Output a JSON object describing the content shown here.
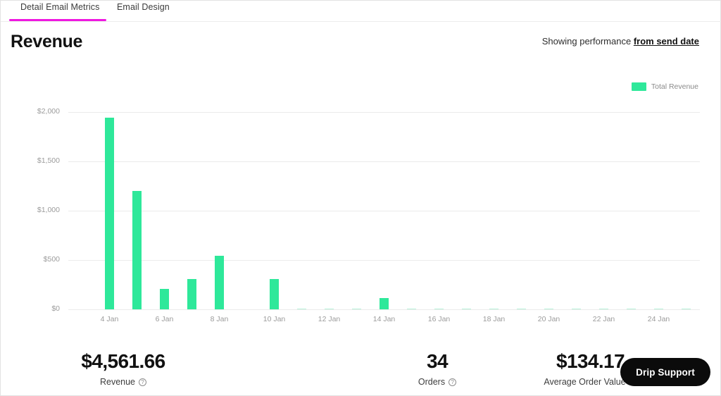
{
  "tabs": [
    {
      "label": "Detail Email Metrics",
      "active": true
    },
    {
      "label": "Email Design",
      "active": false
    }
  ],
  "header": {
    "title": "Revenue",
    "performance_prefix": "Showing performance ",
    "performance_link": "from send date"
  },
  "colors": {
    "accent_tab": "#ef18e0",
    "bar": "#2EE89A",
    "bar_faint": "#b6f2d8",
    "grid": "#ebebeb",
    "support_bg": "#0b0b0b"
  },
  "legend": {
    "swatch_color": "#2EE89A",
    "label": "Total Revenue"
  },
  "chart_data": {
    "type": "bar",
    "title": "Revenue",
    "xlabel": "",
    "ylabel": "",
    "ylim": [
      0,
      2100
    ],
    "grid": true,
    "legend_position": "top-right",
    "yticks": [
      0,
      500,
      1000,
      1500,
      2000
    ],
    "ytick_labels": [
      "$0",
      "$500",
      "$1,000",
      "$1,500",
      "$2,000"
    ],
    "xtick_labels": [
      "4 Jan",
      "6 Jan",
      "8 Jan",
      "10 Jan",
      "12 Jan",
      "14 Jan",
      "16 Jan",
      "18 Jan",
      "20 Jan",
      "22 Jan",
      "24 Jan"
    ],
    "categories": [
      "3 Jan",
      "4 Jan",
      "5 Jan",
      "6 Jan",
      "7 Jan",
      "8 Jan",
      "9 Jan",
      "10 Jan",
      "11 Jan",
      "12 Jan",
      "13 Jan",
      "14 Jan",
      "15 Jan",
      "16 Jan",
      "17 Jan",
      "18 Jan",
      "19 Jan",
      "20 Jan",
      "21 Jan",
      "22 Jan",
      "23 Jan",
      "24 Jan",
      "25 Jan"
    ],
    "series": [
      {
        "name": "Total Revenue",
        "color": "#2EE89A",
        "values": [
          0,
          1940,
          1200,
          205,
          310,
          545,
          0,
          310,
          8,
          6,
          8,
          115,
          6,
          8,
          8,
          8,
          8,
          6,
          8,
          8,
          8,
          6,
          8
        ]
      }
    ]
  },
  "stats": [
    {
      "value": "$4,561.66",
      "label": "Revenue",
      "has_help": true
    },
    {
      "value": "34",
      "label": "Orders",
      "has_help": true
    },
    {
      "value": "$134.17",
      "label": "Average Order Value",
      "has_help": true
    }
  ],
  "support": {
    "label": "Drip Support"
  }
}
